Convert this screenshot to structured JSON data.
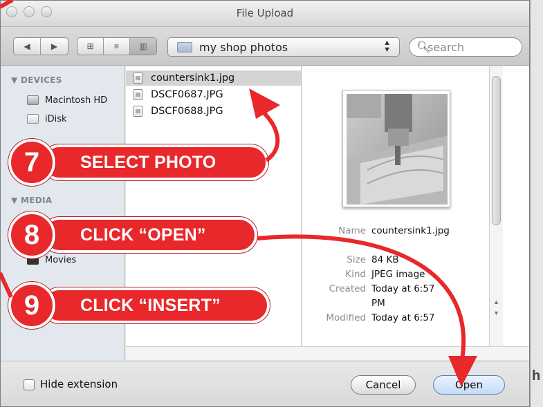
{
  "window": {
    "title": "File Upload"
  },
  "toolbar": {
    "nav_back": "◀",
    "nav_forward": "▶",
    "view_icons": "⊞",
    "view_list": "≡",
    "view_columns": "▥",
    "location": "my shop photos",
    "search_placeholder": "search"
  },
  "sidebar": {
    "devices_header": "▼ DEVICES",
    "devices": [
      {
        "label": "Macintosh HD",
        "icon": "hard-drive-icon"
      },
      {
        "label": "iDisk",
        "icon": "idisk-icon"
      }
    ],
    "media_header": "▼ MEDIA",
    "media": [
      {
        "label": "Movies",
        "icon": "movies-icon"
      }
    ]
  },
  "files": [
    {
      "name": "countersink1.jpg",
      "selected": true
    },
    {
      "name": "DSCF0687.JPG",
      "selected": false
    },
    {
      "name": "DSCF0688.JPG",
      "selected": false
    }
  ],
  "preview": {
    "name_label": "Name",
    "name_value": "countersink1.jpg",
    "size_label": "Size",
    "size_value": "84 KB",
    "kind_label": "Kind",
    "kind_value": "JPEG image",
    "created_label": "Created",
    "created_value": "Today at 6:57 PM",
    "modified_label": "Modified",
    "modified_value": "Today at 6:57"
  },
  "footer": {
    "hide_extension": "Hide extension",
    "cancel": "Cancel",
    "open": "Open"
  },
  "annotations": [
    {
      "number": "7",
      "text": "SELECT PHOTO"
    },
    {
      "number": "8",
      "text": "CLICK “OPEN”"
    },
    {
      "number": "9",
      "text": "CLICK “INSERT”"
    }
  ],
  "colors": {
    "annotation_red": "#e8282b",
    "sidebar_bg": "#e3e8ee",
    "selection": "#d4d4d4"
  },
  "background": {
    "partial_heading": "h"
  }
}
